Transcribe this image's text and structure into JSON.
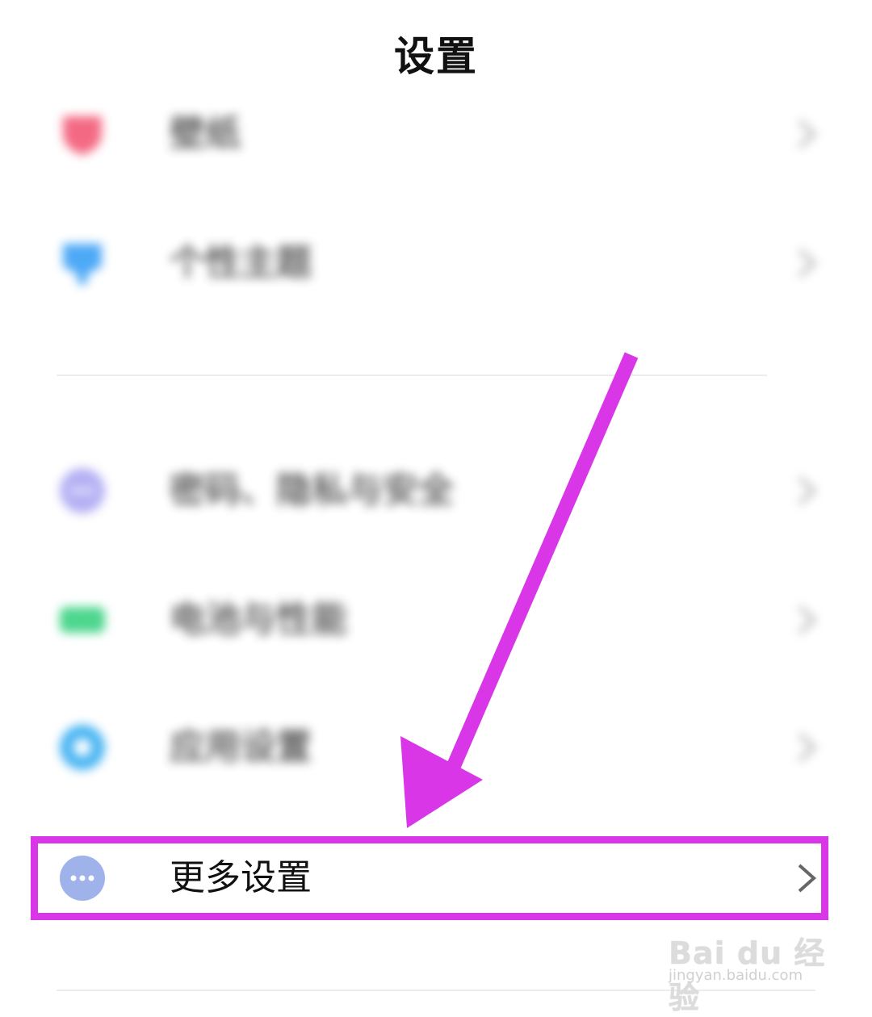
{
  "header": {
    "title": "设置"
  },
  "items": [
    {
      "label": "壁纸",
      "icon": "wallpaper-icon",
      "color": "#f2506e"
    },
    {
      "label": "个性主题",
      "icon": "theme-icon",
      "color": "#2f9af5"
    },
    {
      "label": "密码、隐私与安全",
      "icon": "privacy-icon",
      "color": "#a8a2f2"
    },
    {
      "label": "电池与性能",
      "icon": "battery-icon",
      "color": "#2ecf7a"
    },
    {
      "label": "应用设置",
      "icon": "app-settings-icon",
      "color": "#2aa8f0"
    },
    {
      "label": "更多设置",
      "icon": "more-icon",
      "color": "#9fb3ea"
    }
  ],
  "annotation": {
    "arrow_color": "#d936e8",
    "box_color": "#d936e8"
  },
  "watermark": {
    "main": "Bai du 经验",
    "sub": "jingyan.baidu.com"
  }
}
